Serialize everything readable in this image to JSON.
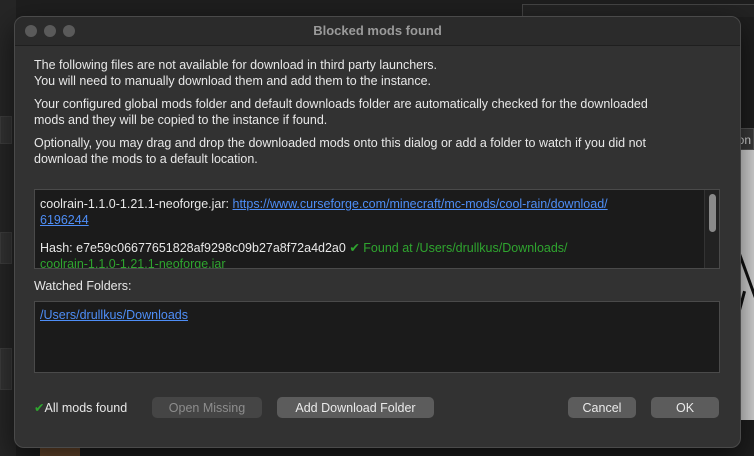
{
  "window": {
    "title": "Blocked mods found"
  },
  "background": {
    "side_tab_label": "oon"
  },
  "intro": {
    "line1": "The following files are not available for download in third party launchers.",
    "line2": "You will need to manually download them and add them to the instance.",
    "line3": "Your configured global mods folder and default downloads folder are automatically checked for the downloaded",
    "line4": "mods and they will be copied to the instance if found.",
    "line5": "Optionally, you may drag and drop the downloaded mods onto this dialog or add a folder to watch if you did not",
    "line6": "download the mods to a default location."
  },
  "mod": {
    "file_name": "coolrain-1.1.0-1.21.1-neoforge.jar:",
    "url_part1": "https://www.curseforge.com/minecraft/mc-mods/cool-rain/download/",
    "url_part2": "6196244",
    "hash_label": "Hash: e7e59c06677651828af9298c09b27a8f72a4d2a0",
    "found_text": "✔ Found at /Users/drullkus/Downloads/",
    "found_file": "coolrain-1.1.0-1.21.1-neoforge.jar"
  },
  "watched": {
    "label": "Watched Folders:",
    "folders": [
      "/Users/drullkus/Downloads"
    ]
  },
  "footer": {
    "status_check": "✔",
    "status_text": "All mods found",
    "open_missing": "Open Missing",
    "add_download_folder": "Add Download Folder",
    "cancel": "Cancel",
    "ok": "OK"
  },
  "colors": {
    "link": "#4e8ef7",
    "found": "#2fa52f",
    "dialog_bg": "#323232"
  }
}
